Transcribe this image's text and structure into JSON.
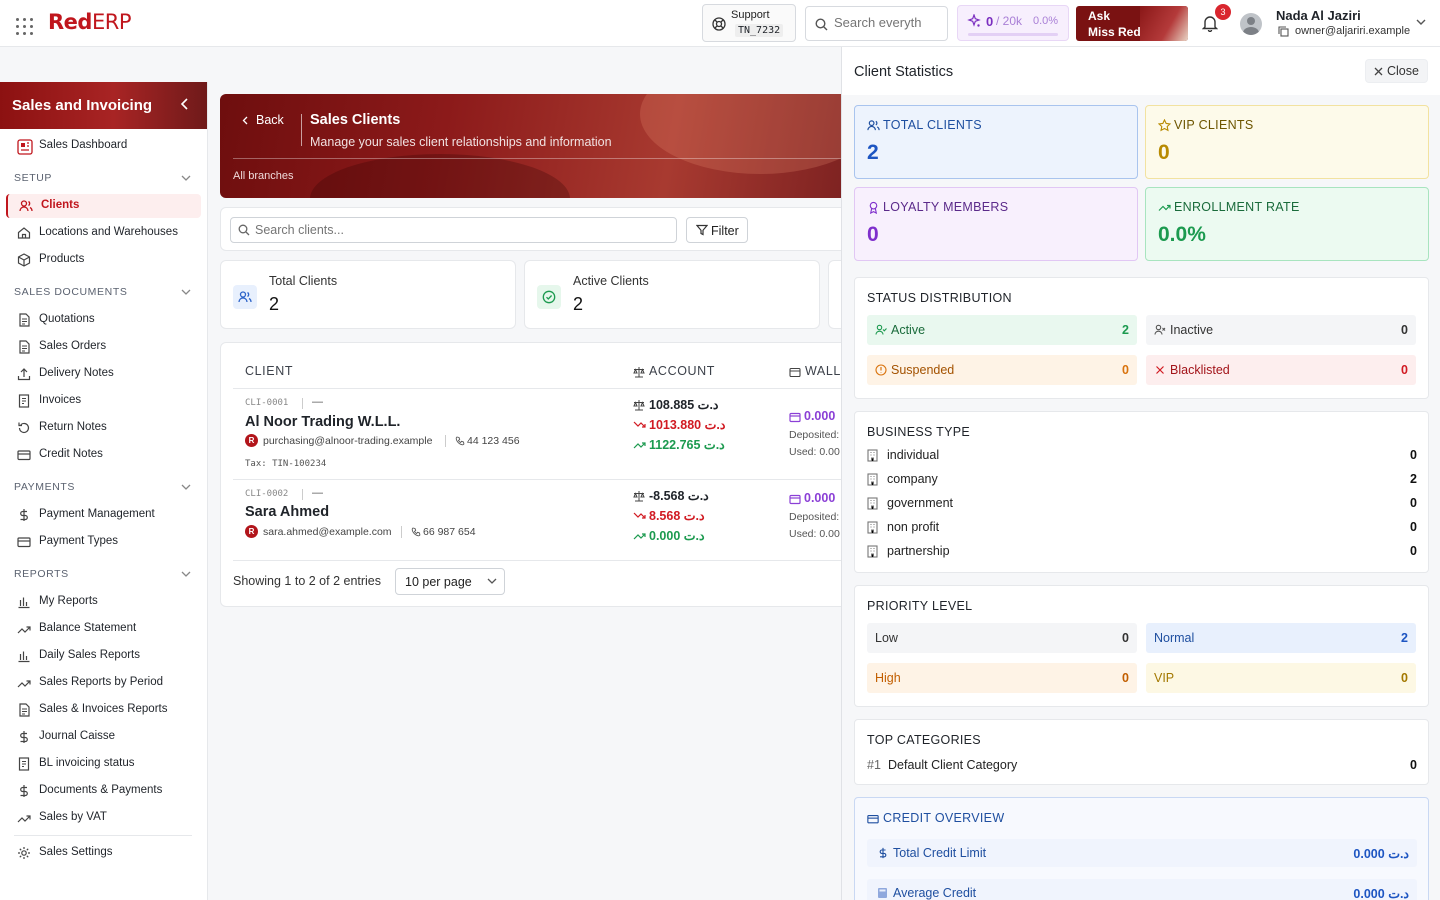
{
  "topbar": {
    "logo_prefix": "Red",
    "logo_suffix": "ERP",
    "support_label": "Support",
    "support_ticket": "TN_7232",
    "search_placeholder": "Search everyth",
    "credits_used": "0",
    "credits_sep": "/ 20k",
    "credits_percent": "0.0%",
    "credits_fraction": 0.0,
    "ask_line1": "Ask",
    "ask_line2": "Miss Red",
    "notification_count": "3",
    "user_name": "Nada Al Jaziri",
    "user_email": "owner@aljariri.example"
  },
  "sidebar": {
    "title": "Sales and Invoicing",
    "dashboard": "Sales Dashboard",
    "sections": {
      "setup": "SETUP",
      "sales_documents": "SALES DOCUMENTS",
      "payments": "PAYMENTS",
      "reports": "REPORTS"
    },
    "setup_items": [
      "Clients",
      "Locations and Warehouses",
      "Products"
    ],
    "document_items": [
      "Quotations",
      "Sales Orders",
      "Delivery Notes",
      "Invoices",
      "Return Notes",
      "Credit Notes"
    ],
    "payment_items": [
      "Payment Management",
      "Payment Types"
    ],
    "report_items": [
      "My Reports",
      "Balance Statement",
      "Daily Sales Reports",
      "Sales Reports by Period",
      "Sales & Invoices Reports",
      "Journal Caisse",
      "BL invoicing status",
      "Documents & Payments",
      "Sales by VAT"
    ],
    "settings": "Sales Settings"
  },
  "hero": {
    "back": "Back",
    "title": "Sales Clients",
    "subtitle": "Manage your sales client relationships and information",
    "branch": "All branches"
  },
  "toolbar": {
    "search_placeholder": "Search clients...",
    "filter": "Filter"
  },
  "stats": {
    "total_label": "Total Clients",
    "total_value": "2",
    "active_label": "Active Clients",
    "active_value": "2"
  },
  "table": {
    "headers": [
      "CLIENT",
      "ACCOUNT",
      "WALL"
    ],
    "rows": [
      {
        "code": "CLI-0001",
        "dash": "—",
        "name": "Al Noor Trading W.L.L.",
        "avatar": "R",
        "email": "purchasing@alnoor-trading.example",
        "phone": "44 123 456",
        "tax": "Tax: TIN-100234",
        "balance": "108.885 د.ت",
        "debit": "1013.880 د.ت",
        "credit": "1122.765 د.ت",
        "wallet": "0.000",
        "deposited": "Deposited:",
        "used": "Used: 0.00"
      },
      {
        "code": "CLI-0002",
        "dash": "—",
        "name": "Sara Ahmed",
        "avatar": "R",
        "email": "sara.ahmed@example.com",
        "phone": "66 987 654",
        "tax": "",
        "balance": "-8.568 د.ت",
        "debit": "8.568 د.ت",
        "credit": "0.000 د.ت",
        "wallet": "0.000",
        "deposited": "Deposited:",
        "used": "Used: 0.00"
      }
    ],
    "pagination_text": "Showing 1 to 2 of 2 entries",
    "per_page": "10 per page"
  },
  "panel": {
    "title": "Client Statistics",
    "close": "Close",
    "kpis": {
      "total_clients_label": "TOTAL CLIENTS",
      "total_clients_value": "2",
      "vip_label": "VIP CLIENTS",
      "vip_value": "0",
      "loyalty_label": "LOYALTY MEMBERS",
      "loyalty_value": "0",
      "enrollment_label": "ENROLLMENT RATE",
      "enrollment_value": "0.0%"
    },
    "status": {
      "heading": "STATUS DISTRIBUTION",
      "active": "Active",
      "active_n": "2",
      "inactive": "Inactive",
      "inactive_n": "0",
      "suspended": "Suspended",
      "suspended_n": "0",
      "blacklisted": "Blacklisted",
      "blacklisted_n": "0"
    },
    "business": {
      "heading": "BUSINESS TYPE",
      "rows": [
        {
          "label": "individual",
          "n": "0"
        },
        {
          "label": "company",
          "n": "2"
        },
        {
          "label": "government",
          "n": "0"
        },
        {
          "label": "non profit",
          "n": "0"
        },
        {
          "label": "partnership",
          "n": "0"
        }
      ]
    },
    "priority": {
      "heading": "PRIORITY LEVEL",
      "low": "Low",
      "low_n": "0",
      "normal": "Normal",
      "normal_n": "2",
      "high": "High",
      "high_n": "0",
      "vip": "VIP",
      "vip_n": "0"
    },
    "categories": {
      "heading": "TOP CATEGORIES",
      "rank": "#1",
      "name": "Default Client Category",
      "n": "0"
    },
    "credit": {
      "heading": "CREDIT OVERVIEW",
      "total_label": "Total Credit Limit",
      "total_value": "0.000 د.ت",
      "avg_label": "Average Credit",
      "avg_value": "0.000 د.ت"
    }
  },
  "colors": {
    "brand_red": "#c0161d",
    "green": "#1c9a4f",
    "purple": "#8b3fd6",
    "blue": "#1d55c2"
  }
}
